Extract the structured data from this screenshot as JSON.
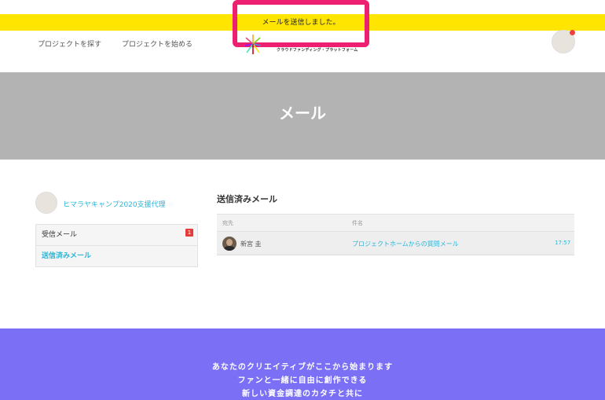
{
  "flash": {
    "message": "メールを送信しました。",
    "bar_color": "#ffe500",
    "highlight_color": "#ec1f71"
  },
  "header": {
    "nav": [
      {
        "label": "プロジェクトを探す"
      },
      {
        "label": "プロジェクトを始める"
      }
    ],
    "logo": {
      "tagline": "クラウドファンディング・プラットフォーム",
      "icon": "colorful-burst-logo"
    },
    "user_avatar": {
      "icon": "user-avatar-icon",
      "notification": true
    }
  },
  "hero": {
    "title": "メール"
  },
  "sidebar": {
    "project_name": "ヒマラヤキャンプ2020支援代理",
    "menu": [
      {
        "label": "受信メール",
        "badge": "1"
      },
      {
        "label": "送信済みメール",
        "active": true
      }
    ]
  },
  "main": {
    "title": "送信済みメール",
    "columns": [
      "宛先",
      "件名"
    ],
    "rows": [
      {
        "recipient": "新宮 圭",
        "subject": "プロジェクトホームからの質問メール",
        "time": "17:57"
      }
    ]
  },
  "footer": {
    "lines": [
      "あなたのクリエイティブがここから始まります",
      "ファンと一緒に自由に創作できる",
      "新しい資金調達のカタチと共に"
    ],
    "bg_color": "#7b70f5"
  },
  "colors": {
    "accent": "#2bb5d8",
    "badge": "#e23c3c",
    "hero": "#b3b3b3"
  }
}
